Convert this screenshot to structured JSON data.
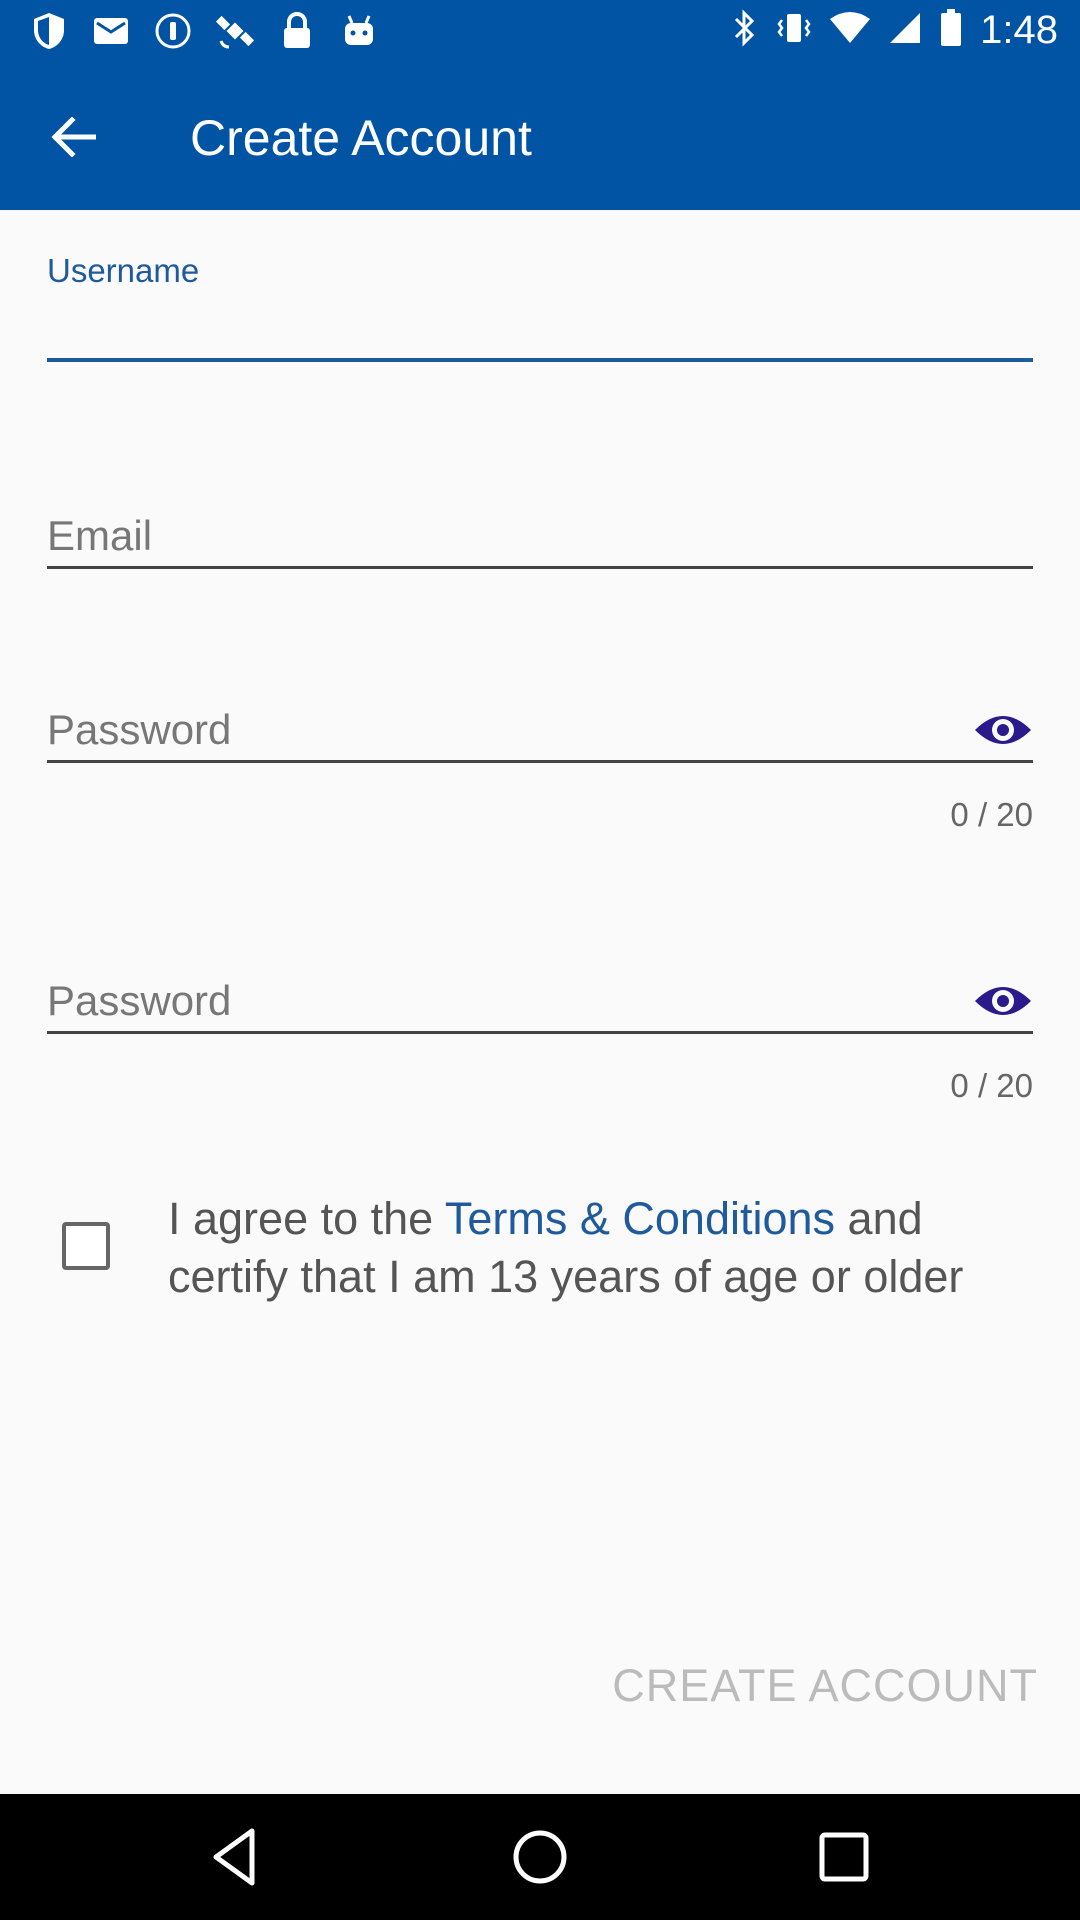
{
  "status_bar": {
    "time": "1:48",
    "left_icons": [
      "shield-icon",
      "mail-icon",
      "info-icon",
      "satellite-icon",
      "lock-icon",
      "android-icon"
    ],
    "right_icons": [
      "bluetooth-icon",
      "vibrate-icon",
      "wifi-icon",
      "signal-icon",
      "battery-icon"
    ]
  },
  "app_bar": {
    "title": "Create Account",
    "back_icon": "arrow-back-icon"
  },
  "form": {
    "username": {
      "label": "Username",
      "value": ""
    },
    "email": {
      "placeholder": "Email",
      "value": ""
    },
    "password": {
      "placeholder": "Password",
      "value": "",
      "counter": "0 / 20",
      "toggle_icon": "eye-icon"
    },
    "confirm_password": {
      "placeholder": "Password",
      "value": "",
      "counter": "0 / 20",
      "toggle_icon": "eye-icon"
    }
  },
  "agreement": {
    "prefix": "I agree to the ",
    "link": "Terms & Conditions",
    "suffix": " and certify that I am 13 years of age or older",
    "checked": false
  },
  "actions": {
    "create_label": "CREATE ACCOUNT"
  },
  "nav_bar": {
    "buttons": [
      "back-triangle-icon",
      "home-circle-icon",
      "recents-square-icon"
    ]
  },
  "colors": {
    "primary": "#0054a3",
    "accent_text": "#1e5a9c",
    "eye_icon": "#2a1a8c",
    "disabled_text": "#bbbbbb"
  }
}
